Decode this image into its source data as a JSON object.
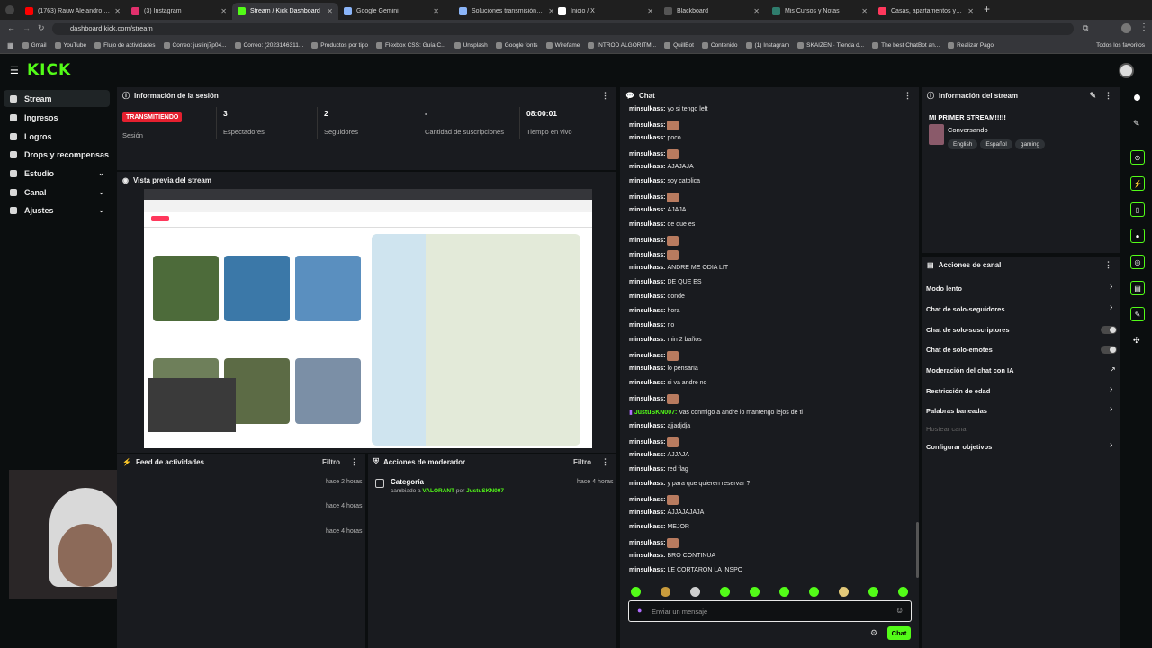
{
  "browser": {
    "tabs": [
      {
        "title": "(1763) Rauw Alejandro - QUÉ R",
        "color": "#ff0000"
      },
      {
        "title": "(3) Instagram",
        "color": "#e1306c"
      },
      {
        "title": "Stream / Kick Dashboard",
        "color": "#53fc18"
      },
      {
        "title": "Google Gemini",
        "color": "#8ab4f8"
      },
      {
        "title": "Soluciones transmisión OBS",
        "color": "#8ab4f8"
      },
      {
        "title": "Inicio / X",
        "color": "#ffffff"
      },
      {
        "title": "Blackboard",
        "color": "#555555"
      },
      {
        "title": "Mis Cursos y Notas",
        "color": "#2f7d6d"
      },
      {
        "title": "Casas, apartamentos y alquile",
        "color": "#ff385c"
      }
    ],
    "url": "dashboard.kick.com/stream",
    "bookmarks": [
      "Gmail",
      "YouTube",
      "Flujo de actividades",
      "Correo: justinj7p04...",
      "Correo: (2023146311...",
      "Productos por tipo",
      "Flexbox CSS: Guía C...",
      "Unsplash",
      "Google fonts",
      "Wirefame",
      "INTROD ALGORITM...",
      "QuillBot",
      "Contenido",
      "(1) Instagram",
      "SKAIZEN · Tienda d...",
      "The best ChatBot an...",
      "Realizar Pago"
    ],
    "all_bookmarks": "Todos los favoritos"
  },
  "brand": {
    "logo": "KICK",
    "accent": "#53fc18"
  },
  "sidebar": {
    "items": [
      {
        "label": "Stream",
        "icon": "broadcast-icon"
      },
      {
        "label": "Ingresos",
        "icon": "money-icon"
      },
      {
        "label": "Logros",
        "icon": "trophy-icon"
      },
      {
        "label": "Drops y recompensas",
        "icon": "gift-icon"
      },
      {
        "label": "Estudio",
        "icon": "studio-icon"
      },
      {
        "label": "Canal",
        "icon": "channel-icon"
      },
      {
        "label": "Ajustes",
        "icon": "gear-icon"
      }
    ]
  },
  "session": {
    "title": "Información de la sesión",
    "status": "TRANSMITIENDO",
    "status_label": "Sesión",
    "viewers": "3",
    "viewers_label": "Espectadores",
    "followers": "2",
    "followers_label": "Seguidores",
    "subs": "-",
    "subs_label": "Cantidad de suscripciones",
    "live_time": "08:00:01",
    "live_label": "Tiempo en vivo"
  },
  "preview": {
    "title": "Vista previa del stream"
  },
  "feed": {
    "title": "Feed de actividades",
    "filter": "Filtro",
    "times": [
      "hace 2 horas",
      "hace 4 horas",
      "hace 4 horas"
    ]
  },
  "mod": {
    "title": "Acciones de moderador",
    "filter": "Filtro",
    "item_title": "Categoría",
    "item_time": "hace 4 horas",
    "item_prefix": "cambiado a",
    "item_value": "VALORANT",
    "item_by": "por",
    "item_user": "JustuSKN007"
  },
  "chat": {
    "title": "Chat",
    "messages": [
      {
        "user": "minsulkass:",
        "text": "yo si tengo left"
      },
      {
        "user": "minsulkass:",
        "text": "",
        "emote": true
      },
      {
        "user": "minsulkass:",
        "text": "poco"
      },
      {
        "user": "minsulkass:",
        "text": "",
        "emote": true
      },
      {
        "user": "minsulkass:",
        "text": "AJAJAJA"
      },
      {
        "user": "minsulkass:",
        "text": "soy catolica"
      },
      {
        "user": "minsulkass:",
        "text": "",
        "emote": true
      },
      {
        "user": "minsulkass:",
        "text": "AJAJA"
      },
      {
        "user": "minsulkass:",
        "text": "de que es"
      },
      {
        "user": "minsulkass:",
        "text": "",
        "emote": true
      },
      {
        "user": "minsulkass:",
        "text": "",
        "emote": true
      },
      {
        "user": "minsulkass:",
        "text": "ANDRE ME ODIA LIT"
      },
      {
        "user": "minsulkass:",
        "text": "DE QUE ES"
      },
      {
        "user": "minsulkass:",
        "text": "donde"
      },
      {
        "user": "minsulkass:",
        "text": "hora"
      },
      {
        "user": "minsulkass:",
        "text": "no"
      },
      {
        "user": "minsulkass:",
        "text": "min 2 baños"
      },
      {
        "user": "minsulkass:",
        "text": "",
        "emote": true
      },
      {
        "user": "minsulkass:",
        "text": "lo pensaria"
      },
      {
        "user": "minsulkass:",
        "text": "si va andre no"
      },
      {
        "user": "minsulkass:",
        "text": "",
        "emote": true
      },
      {
        "user": "JustuSKN007:",
        "text": "Vas conmigo a andre lo mantengo lejos de ti",
        "own": true
      },
      {
        "user": "minsulkass:",
        "text": "ajjadjdja"
      },
      {
        "user": "minsulkass:",
        "text": "",
        "emote": true
      },
      {
        "user": "minsulkass:",
        "text": "AJJAJA"
      },
      {
        "user": "minsulkass:",
        "text": "red flag"
      },
      {
        "user": "minsulkass:",
        "text": "y para que quieren reservar ?"
      },
      {
        "user": "minsulkass:",
        "text": "",
        "emote": true
      },
      {
        "user": "minsulkass:",
        "text": "AJJAJAJAJA"
      },
      {
        "user": "minsulkass:",
        "text": "MEJOR"
      },
      {
        "user": "minsulkass:",
        "text": "",
        "emote": true
      },
      {
        "user": "minsulkass:",
        "text": "BRO CONTINUA"
      },
      {
        "user": "minsulkass:",
        "text": "LE CORTARON LA INSPO"
      }
    ],
    "placeholder": "Enviar un mensaje",
    "send": "Chat"
  },
  "stream_info": {
    "title": "Información del stream",
    "stream_title": "MI PRIMER STREAM!!!!!",
    "category": "Conversando",
    "tags": [
      "English",
      "Español",
      "gaming"
    ]
  },
  "channel_actions": {
    "title": "Acciones de canal",
    "items": [
      {
        "label": "Modo lento",
        "control": "chevron"
      },
      {
        "label": "Chat de solo-seguidores",
        "control": "chevron"
      },
      {
        "label": "Chat de solo-suscriptores",
        "control": "toggle"
      },
      {
        "label": "Chat de solo-emotes",
        "control": "toggle"
      },
      {
        "label": "Moderación del chat con IA",
        "control": "external"
      },
      {
        "label": "Restricción de edad",
        "control": "chevron"
      },
      {
        "label": "Palabras baneadas",
        "control": "chevron"
      },
      {
        "label": "Hostear canal",
        "control": "none",
        "disabled": true
      },
      {
        "label": "Configurar objetivos",
        "control": "chevron"
      }
    ]
  }
}
